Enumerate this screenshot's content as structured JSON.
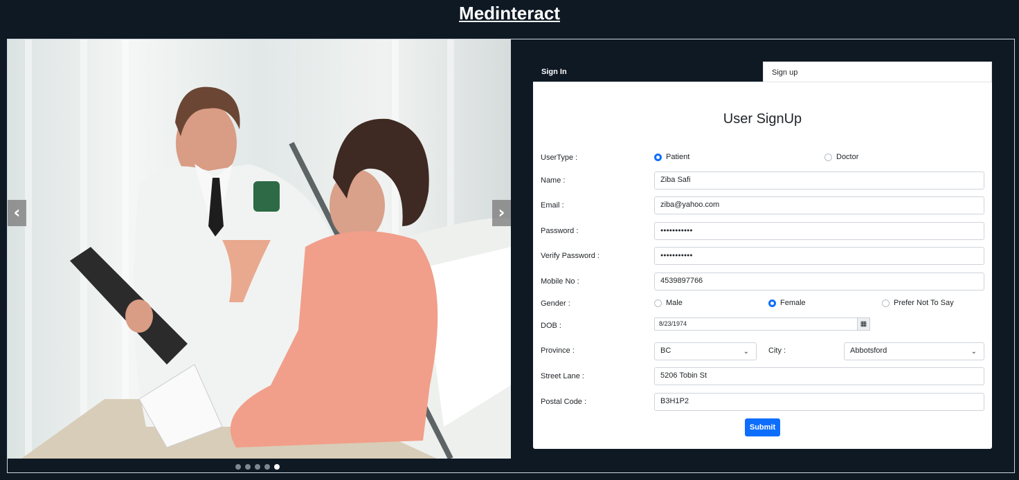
{
  "app": {
    "title": "Medinteract"
  },
  "carousel": {
    "prev_glyph": "‹",
    "next_glyph": "›",
    "slide_count": 5,
    "active_slide": 5
  },
  "tabs": {
    "signin_label": "Sign In",
    "signup_label": "Sign up"
  },
  "form": {
    "title": "User SignUp",
    "usertype_label": "UserType :",
    "usertype_options": [
      "Patient",
      "Doctor"
    ],
    "usertype_selected": "Patient",
    "name_label": "Name :",
    "name_value": "Ziba Safi",
    "email_label": "Email :",
    "email_value": "ziba@yahoo.com",
    "password_label": "Password :",
    "password_value": "●●●●●●●●●●●",
    "verify_password_label": "Verify Password :",
    "verify_password_value": "●●●●●●●●●●●",
    "mobile_label": "Mobile No :",
    "mobile_value": "4539897766",
    "gender_label": "Gender :",
    "gender_options": [
      "Male",
      "Female",
      "Prefer Not To Say"
    ],
    "gender_selected": "Female",
    "dob_label": "DOB :",
    "dob_value": "8/23/1974",
    "province_label": "Province :",
    "province_value": "BC",
    "city_label": "City :",
    "city_value": "Abbotsford",
    "street_label": "Street Lane :",
    "street_value": "5206 Tobin St",
    "postal_label": "Postal Code :",
    "postal_value": "B3H1P2",
    "submit_label": "Submit"
  },
  "colors": {
    "background": "#0f1924",
    "accent": "#0d6efd"
  }
}
